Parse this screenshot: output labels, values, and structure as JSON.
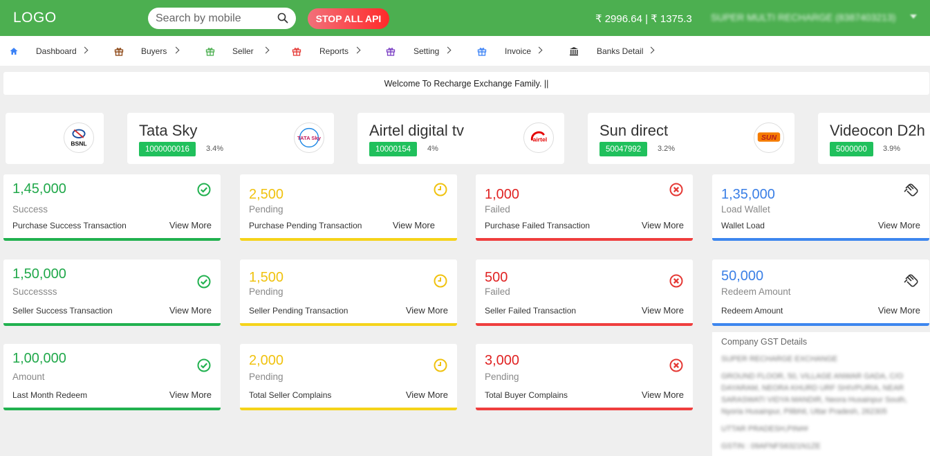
{
  "header": {
    "logo": "LOGO",
    "search_placeholder": "Search by mobile",
    "stop_button": "STOP ALL API",
    "balance": "₹ 2996.64 | ₹ 1375.3",
    "user_name": "SUPER MULTI RECHARGE (8387403213)"
  },
  "nav": [
    {
      "label": "Dashboard",
      "icon": "home-icon",
      "color": "#3b82f6"
    },
    {
      "label": "Buyers",
      "icon": "gift-icon",
      "color": "#8b4513"
    },
    {
      "label": "Seller",
      "icon": "gift-icon",
      "color": "#4caf50"
    },
    {
      "label": "Reports",
      "icon": "gift-icon",
      "color": "#e53935"
    },
    {
      "label": "Setting",
      "icon": "gift-icon",
      "color": "#7b3fc4"
    },
    {
      "label": "Invoice",
      "icon": "gift-icon",
      "color": "#3b82f6"
    },
    {
      "label": "Banks Detail",
      "icon": "bank-icon",
      "color": "#333333"
    }
  ],
  "welcome": "Welcome To Recharge Exchange Family.  ||",
  "operators": [
    {
      "name": "",
      "id": "",
      "pct": "",
      "logo_text": "BSNL"
    },
    {
      "name": "Tata Sky",
      "id": "1000000016",
      "pct": "3.4%",
      "logo_text": "TATA Sky"
    },
    {
      "name": "Airtel digital tv",
      "id": "10000154",
      "pct": "4%",
      "logo_text": "airtel"
    },
    {
      "name": "Sun direct",
      "id": "50047992",
      "pct": "3.2%",
      "logo_text": "SUN"
    },
    {
      "name": "Videocon D2h",
      "id": "5000000",
      "pct": "3.9%",
      "logo_text": ""
    }
  ],
  "stats": {
    "row1": [
      {
        "value": "1,45,000",
        "status": "Success",
        "desc": "Purchase Success Transaction",
        "more": "View More",
        "icon": "check-circle-icon"
      },
      {
        "value": "2,500",
        "status": "Pending",
        "desc": "Purchase Pending Transaction",
        "more": "View More",
        "icon": "clock-icon"
      },
      {
        "value": "1,000",
        "status": "Failed",
        "desc": "Purchase Failed Transaction",
        "more": "View More",
        "icon": "x-circle-icon"
      },
      {
        "value": "1,35,000",
        "status": "Load Wallet",
        "desc": "Wallet Load",
        "more": "View More",
        "icon": "hand-icon"
      }
    ],
    "row2": [
      {
        "value": "1,50,000",
        "status": "Successss",
        "desc": "Seller Success Transaction",
        "more": "View More",
        "icon": "check-circle-icon"
      },
      {
        "value": "1,500",
        "status": "Pending",
        "desc": "Seller Pending Transaction",
        "more": "View More",
        "icon": "clock-icon"
      },
      {
        "value": "500",
        "status": "Failed",
        "desc": "Seller Failed Transaction",
        "more": "View More",
        "icon": "x-circle-icon"
      },
      {
        "value": "50,000",
        "status": "Redeem Amount",
        "desc": "Redeem Amount",
        "more": "View More",
        "icon": "hand-icon"
      }
    ],
    "row3": [
      {
        "value": "1,00,000",
        "status": "Amount",
        "desc": "Last Month Redeem",
        "more": "View More",
        "icon": "check-circle-icon"
      },
      {
        "value": "2,000",
        "status": "Pending",
        "desc": "Total Seller Complains",
        "more": "View More",
        "icon": "clock-icon"
      },
      {
        "value": "3,000",
        "status": "Pending",
        "desc": "Total Buyer Complains",
        "more": "View More",
        "icon": "x-circle-icon"
      }
    ]
  },
  "gst": {
    "title": "Company GST Details",
    "lines": [
      "SUPER RECHARGE EXCHANGE",
      "GROUND FLOOR, 50, VILLAGE ANWAR GADA, C/O",
      "DAYARAM, NEORA KHURD URF SHIVPURIA, NEAR",
      "SARASWATI VIDYA MANDIR, Neora Husainpur South,",
      "Nyoria Husainpur, Pilibhit, Uttar Pradesh, 262305",
      "UTTAR PRADESH,PIN##",
      "GSTIN : 09AFNFS6321N1ZE"
    ]
  },
  "colors": {
    "header_green": "#4caf50",
    "success": "#21b14f",
    "pending": "#f5d31a",
    "failed": "#ef3e3e",
    "wallet": "#3d86ee",
    "badge": "#20c05c"
  }
}
